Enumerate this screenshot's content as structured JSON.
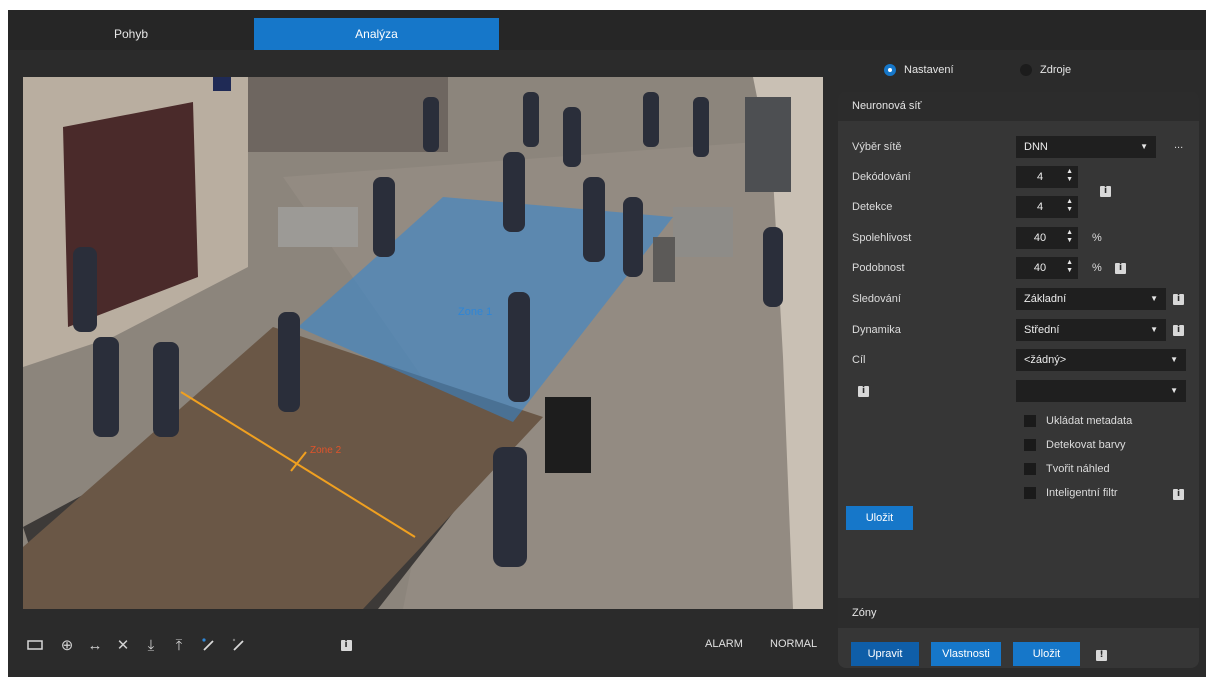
{
  "tabs": [
    {
      "label": "Pohyb",
      "active": false
    },
    {
      "label": "Analýza",
      "active": true
    }
  ],
  "video": {
    "zones": [
      {
        "label": "Zone 1",
        "color": "#2f86d6"
      },
      {
        "label": "Zone 2",
        "color": "#e0532a"
      }
    ]
  },
  "toolbar": {
    "icons": [
      "rectangle-icon",
      "add-circle-icon",
      "horizontal-arrows-icon",
      "close-icon",
      "arrow-down-icon",
      "arrow-up-icon",
      "pencil-add-icon",
      "pencil-icon",
      "info-icon"
    ],
    "status_alarm": "ALARM",
    "status_normal": "NORMAL"
  },
  "right": {
    "radio_settings": "Nastavení",
    "radio_sources": "Zdroje",
    "neural": {
      "title": "Neuronová síť",
      "network_label": "Výběr sítě",
      "network_value": "DNN",
      "network_more": "...",
      "decoding_label": "Dekódování",
      "decoding_value": "4",
      "detection_label": "Detekce",
      "detection_value": "4",
      "reliability_label": "Spolehlivost",
      "reliability_value": "40",
      "reliability_unit": "%",
      "similarity_label": "Podobnost",
      "similarity_value": "40",
      "similarity_unit": "%",
      "tracking_label": "Sledování",
      "tracking_value": "Základní",
      "dynamics_label": "Dynamika",
      "dynamics_value": "Střední",
      "target_label": "Cíl",
      "target_value": "<žádný>",
      "extra_value": "",
      "checkboxes": [
        {
          "label": "Ukládat metadata",
          "checked": false
        },
        {
          "label": "Detekovat barvy",
          "checked": false
        },
        {
          "label": "Tvořit náhled",
          "checked": false
        },
        {
          "label": "Inteligentní filtr",
          "checked": false
        }
      ],
      "save_label": "Uložit"
    },
    "zones": {
      "title": "Zóny",
      "edit_label": "Upravit",
      "props_label": "Vlastnosti",
      "save_label": "Uložit"
    }
  },
  "colors": {
    "accent": "#1677c9",
    "panel": "#363636",
    "background": "#2b2b2b"
  }
}
